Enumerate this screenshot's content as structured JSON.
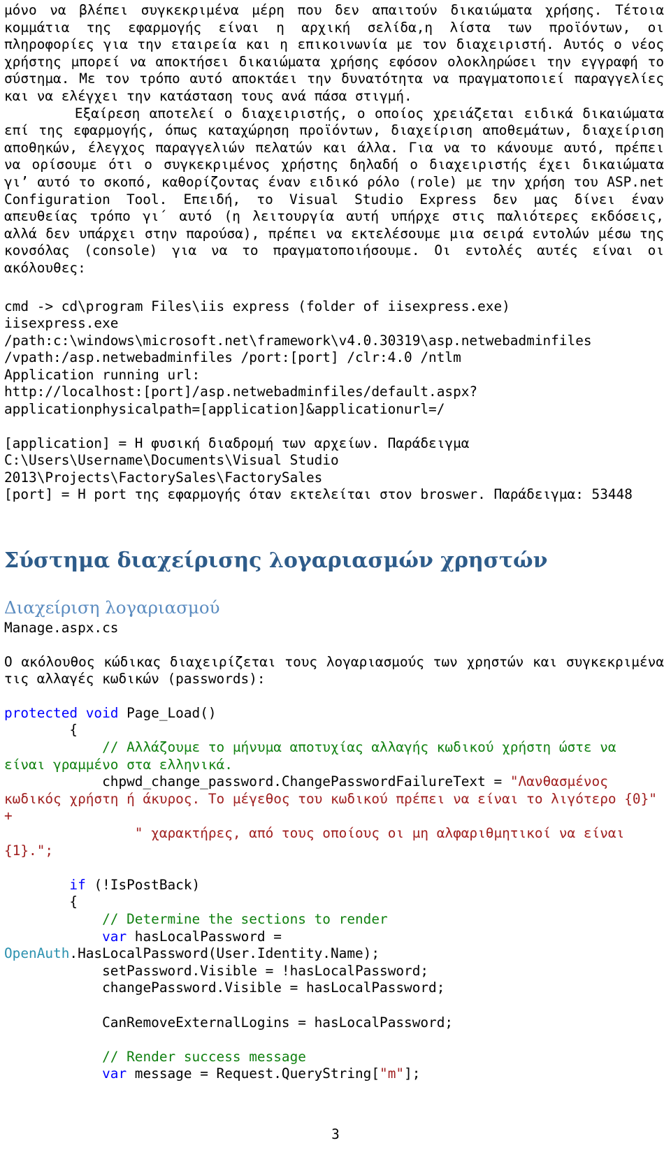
{
  "document": {
    "page_number": "3",
    "language": "el",
    "colors": {
      "h1": "#2e5c8a",
      "h2": "#5b8cc0",
      "keyword": "#0000ff",
      "comment": "#108010",
      "string": "#a02020",
      "type": "#2b91af",
      "text": "#000000",
      "background": "#ffffff"
    }
  },
  "body": {
    "paragraph_1": "μόνο να βλέπει συγκεκριμένα μέρη που δεν απαιτούν δικαιώματα χρήσης. Τέτοια κομμάτια της εφαρμογής είναι η αρχική σελίδα,η λίστα των προϊόντων, οι πληροφορίες για την εταιρεία και η επικοινωνία με τον διαχειριστή. Αυτός ο νέος χρήστης μπορεί να αποκτήσει δικαιώματα χρήσης εφόσον ολοκληρώσει την εγγραφή το σύστημα. Με τον τρόπο αυτό αποκτάει την δυνατότητα να πραγματοποιεί παραγγελίες και να ελέγχει την κατάσταση τους ανά πάσα στιγμή.",
    "paragraph_2": "Εξαίρεση αποτελεί ο διαχειριστής, ο οποίος χρειάζεται ειδικά δικαιώματα επί της εφαρμογής, όπως καταχώρηση προϊόντων, διαχείριση αποθεμάτων, διαχείριση αποθηκών, έλεγχος παραγγελιών πελατών και άλλα. Για να το κάνουμε αυτό, πρέπει να ορίσουμε ότι ο συγκεκριμένος χρήστης δηλαδή ο διαχειριστής έχει δικαιώματα γι’ αυτό το σκοπό, καθορίζοντας έναν ειδικό ρόλο (role) με την χρήση του ASP.net Configuration Tool. Επειδή, το Visual Studio Express δεν μας δίνει έναν απευθείας τρόπο γι΄ αυτό (η λειτουργία αυτή υπήρχε στις παλιότερες εκδόσεις, αλλά δεν υπάρχει στην παρούσα), πρέπει να εκτελέσουμε μια σειρά εντολών μέσω της κονσόλας (console) για να το πραγματοποιήσουμε. Οι εντολές αυτές είναι οι ακόλουθες:"
  },
  "console_block": {
    "commands": "cmd -> cd\\program Files\\iis express (folder of iisexpress.exe)\niisexpress.exe\n/path:c:\\windows\\microsoft.net\\framework\\v4.0.30319\\asp.netwebadminfiles\n/vpath:/asp.netwebadminfiles /port:[port] /clr:4.0 /ntlm\nApplication running url:\nhttp://localhost:[port]/asp.netwebadminfiles/default.aspx?applicationphysicalpath=[application]&applicationurl=/",
    "legend": "[application] = Η φυσική διαδρομή των αρχείων. Παράδειγμα\nC:\\Users\\Username\\Documents\\Visual Studio\n2013\\Projects\\FactorySales\\FactorySales\n[port] = Η port της εφαρμογής όταν εκτελείται στον broswer. Παράδειγμα: 53448"
  },
  "headings": {
    "h1": "Σύστημα διαχείρισης λογαριασμών χρηστών",
    "h2": "Διαχείριση λογαριασμού"
  },
  "file": {
    "name": "Manage.aspx.cs",
    "description": "Ο ακόλουθος κώδικας διαχειρίζεται τους λογαριασμούς των χρηστών και συγκεκριμένα τις αλλαγές κωδικών (passwords):"
  },
  "code": {
    "line_01_kw": "protected void",
    "line_01_rest": " Page_Load()",
    "line_02": "        {",
    "line_03_comment": "            // Αλλάζουμε το μήνυμα αποτυχίας αλλαγής κωδικού χρήστη ώστε να είναι γραμμένο στα ελληνικά.",
    "line_04_plain": "            chpwd_change_password.ChangePasswordFailureText = ",
    "line_04_string": "\"Λανθασμένος κωδικός χρήστη ή άκυρος. Το μέγεθος του κωδικού πρέπει να είναι το λιγότερο {0}\"",
    "line_04_tail": " +",
    "line_05_string": "                \" χαρακτήρες, από τους οποίους οι μη αλφαριθμητικοί να είναι {1}.\"",
    "line_05_tail": ";",
    "line_06_kw": "if",
    "line_06_rest": " (!IsPostBack)",
    "line_07": "        {",
    "line_08_comment": "            // Determine the sections to render",
    "line_09_kw": "var",
    "line_09_rest": " hasLocalPassword = ",
    "line_10_type": "OpenAuth",
    "line_10_rest": ".HasLocalPassword(User.Identity.Name);",
    "line_11": "            setPassword.Visible = !hasLocalPassword;",
    "line_12": "            changePassword.Visible = hasLocalPassword;",
    "line_13": "            CanRemoveExternalLogins = hasLocalPassword;",
    "line_14_comment": "            // Render success message",
    "line_15_kw": "var",
    "line_15_mid": " message = Request.QueryString[",
    "line_15_string": "\"m\"",
    "line_15_tail": "];"
  }
}
